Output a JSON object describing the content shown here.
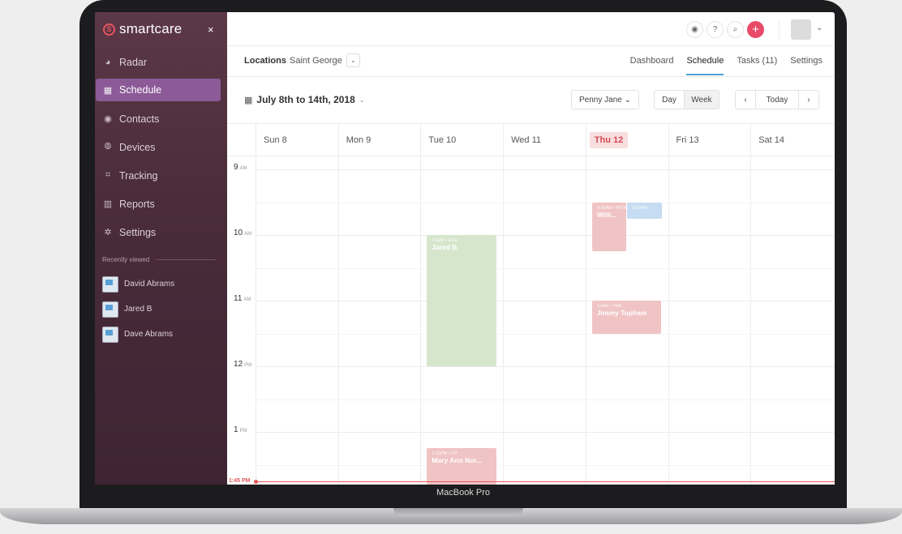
{
  "device": {
    "label": "MacBook Pro"
  },
  "sidebar": {
    "brand": "smartcare",
    "brand_icon": "smartcare-s-logo",
    "close_label": "×",
    "nav": [
      {
        "label": "Radar",
        "icon": "radar-icon",
        "glyph": "◕"
      },
      {
        "label": "Schedule",
        "icon": "calendar-icon",
        "glyph": "▦",
        "active": true
      },
      {
        "label": "Contacts",
        "icon": "contact-icon",
        "glyph": "◉"
      },
      {
        "label": "Devices",
        "icon": "device-icon",
        "glyph": "⦾"
      },
      {
        "label": "Tracking",
        "icon": "tracking-icon",
        "glyph": "⌗"
      },
      {
        "label": "Reports",
        "icon": "chart-icon",
        "glyph": "▥"
      },
      {
        "label": "Settings",
        "icon": "gear-icon",
        "glyph": "✲"
      }
    ],
    "recent_heading": "Recently viewed",
    "recent": [
      "David Abrams",
      "Jared B",
      "Dave Abrams"
    ]
  },
  "topbar": {
    "icons": [
      "eye-icon",
      "help-icon",
      "search-icon",
      "add-icon"
    ],
    "help_glyph": "?",
    "add_glyph": "+",
    "accent": "#e84a67"
  },
  "subbar": {
    "locations_label": "Locations",
    "location_value": "Saint George",
    "tabs": [
      "Dashboard",
      "Schedule",
      "Tasks (11)",
      "Settings"
    ]
  },
  "toolbar": {
    "range": "July 8th to 14th, 2018",
    "staff": "Penny Jane",
    "view_day": "Day",
    "view_week": "Week",
    "prev": "‹",
    "today": "Today",
    "next": "›"
  },
  "calendar": {
    "days": [
      "Sun 8",
      "Mon 9",
      "Tue 10",
      "Wed 11",
      "Thu 12",
      "Fri 13",
      "Sat 14"
    ],
    "today_index": 4,
    "hours": [
      {
        "num": "9",
        "ampm": "AM"
      },
      {
        "num": "10",
        "ampm": "AM"
      },
      {
        "num": "11",
        "ampm": "AM"
      },
      {
        "num": "12",
        "ampm": "PM"
      },
      {
        "num": "1",
        "ampm": "PM"
      }
    ],
    "now_label": "1:45 PM",
    "events": [
      {
        "time": "10AM • EVAL",
        "name": "Jared B",
        "day": "Tue 10",
        "start": "10:00",
        "end": "12:00",
        "color": "green"
      },
      {
        "time": "9:30AM • INTR",
        "name": "Willi...",
        "day": "Thu 12",
        "start": "9:30",
        "end": "10:15",
        "color": "red",
        "lane": 0
      },
      {
        "time": "9:30AM",
        "name": "",
        "day": "Thu 12",
        "start": "9:30",
        "end": "9:45",
        "color": "blue",
        "lane": 1
      },
      {
        "time": "11AM • TWA",
        "name": "Jimmy Topham",
        "day": "Thu 12",
        "start": "11:00",
        "end": "11:30",
        "color": "red"
      },
      {
        "time": "1:15PM • FIT",
        "name": "Mary Ann Nor...",
        "day": "Tue 10",
        "start": "13:15",
        "end": "14:00",
        "color": "red"
      }
    ]
  }
}
